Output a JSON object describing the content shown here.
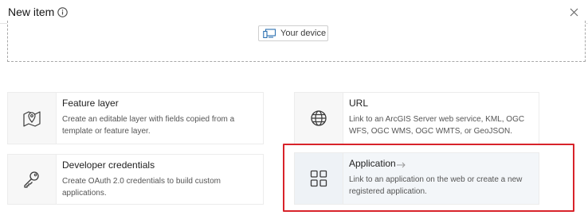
{
  "dialog": {
    "title": "New item",
    "info_icon": "info-circle-icon",
    "close_icon": "close-x-icon"
  },
  "upload": {
    "device_label": "Your device",
    "device_icon": "device-icon"
  },
  "cards": [
    {
      "key": "feature-layer",
      "title": "Feature layer",
      "description": "Create an editable layer with fields copied from a template or feature layer.",
      "icon": "map-pin-icon"
    },
    {
      "key": "url",
      "title": "URL",
      "description": "Link to an ArcGIS Server web service, KML, OGC WFS, OGC WMS, OGC WMTS, or GeoJSON.",
      "icon": "globe-icon"
    },
    {
      "key": "developer-credentials",
      "title": "Developer credentials",
      "description": "Create OAuth 2.0 credentials to build custom applications.",
      "icon": "key-icon"
    },
    {
      "key": "application",
      "title": "Application",
      "description": "Link to an application on the web or create a new registered application.",
      "icon": "app-grid-icon"
    }
  ],
  "colors": {
    "highlight": "#d8232a",
    "selected_card_bg": "#f3f6f9"
  }
}
